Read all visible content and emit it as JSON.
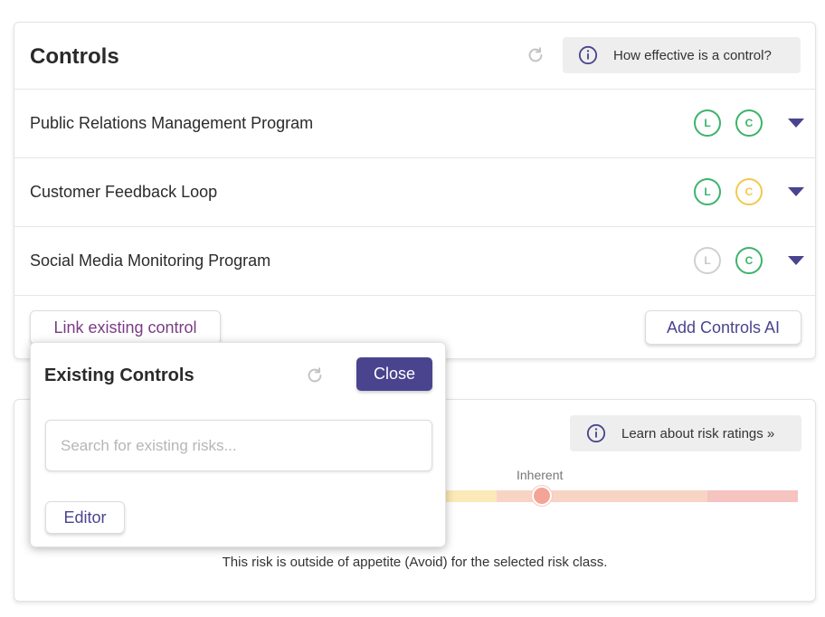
{
  "controls": {
    "title": "Controls",
    "info_button_label": "How effective is a control?",
    "rows": [
      {
        "name": "Public Relations Management Program",
        "badge_l": "L",
        "badge_c": "C",
        "l_status": "green",
        "c_status": "green"
      },
      {
        "name": "Customer Feedback Loop",
        "badge_l": "L",
        "badge_c": "C",
        "l_status": "green",
        "c_status": "yellow"
      },
      {
        "name": "Social Media Monitoring Program",
        "badge_l": "L",
        "badge_c": "C",
        "l_status": "grey",
        "c_status": "green"
      }
    ],
    "link_existing_label": "Link existing control",
    "add_controls_label": "Add Controls AI"
  },
  "popover": {
    "title": "Existing Controls",
    "close_label": "Close",
    "search_placeholder": "Search for existing risks...",
    "editor_label": "Editor"
  },
  "risk": {
    "learn_button_label": "Learn about risk ratings »",
    "inherent_label": "Inherent",
    "appetite_text": "This risk is outside of appetite (Avoid) for the selected risk class."
  },
  "colors": {
    "accent": "#4a448f",
    "green": "#3db36b",
    "yellow": "#f2c94c",
    "grey": "#d0d0d0",
    "scale_yellow": "#fbe9b7",
    "scale_peach": "#f8d4c5",
    "scale_red": "#f5c3c0"
  }
}
